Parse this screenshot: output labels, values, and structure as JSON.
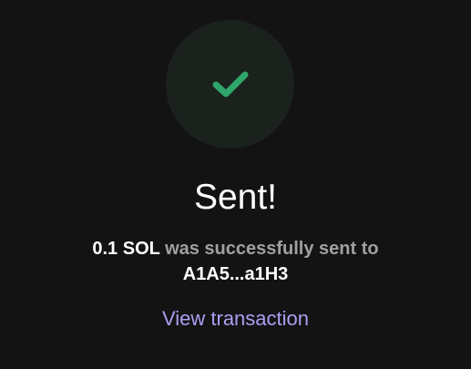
{
  "status": {
    "icon": "checkmark-icon",
    "title": "Sent!",
    "amount": "0.1 SOL",
    "message_middle": "was successfully sent to",
    "recipient": "A1A5...a1H3"
  },
  "actions": {
    "view_transaction_label": "View transaction"
  },
  "colors": {
    "background": "#131313",
    "circle": "#1b221e",
    "check": "#2fa66a",
    "link": "#ab9ff2",
    "muted_text": "#a0a0a0"
  }
}
